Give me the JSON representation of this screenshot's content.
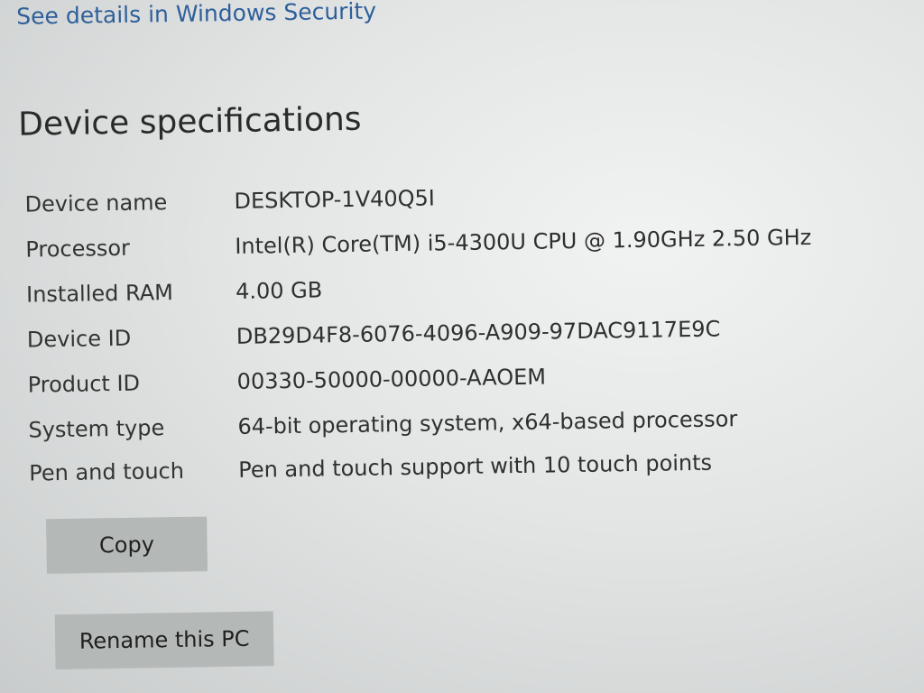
{
  "security_link": "See details in Windows Security",
  "section_title": "Device specifications",
  "specs": [
    {
      "label": "Device name",
      "value": "DESKTOP-1V40Q5I"
    },
    {
      "label": "Processor",
      "value": "Intel(R) Core(TM) i5-4300U CPU @ 1.90GHz   2.50 GHz"
    },
    {
      "label": "Installed RAM",
      "value": "4.00 GB"
    },
    {
      "label": "Device ID",
      "value": "DB29D4F8-6076-4096-A909-97DAC9117E9C"
    },
    {
      "label": "Product ID",
      "value": "00330-50000-00000-AAOEM"
    },
    {
      "label": "System type",
      "value": "64-bit operating system, x64-based processor"
    },
    {
      "label": "Pen and touch",
      "value": "Pen and touch support with 10 touch points"
    }
  ],
  "buttons": {
    "copy": "Copy",
    "rename": "Rename this PC"
  }
}
